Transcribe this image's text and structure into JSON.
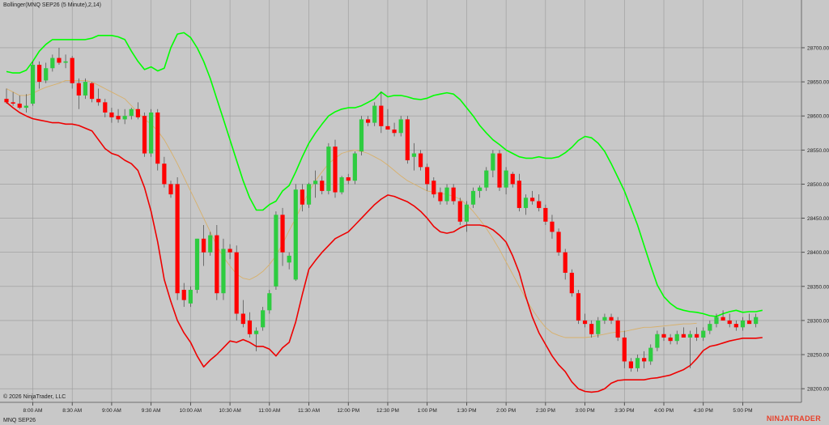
{
  "indicator_label": "Bollinger(MNQ SEP26 (5 Minute),2,14)",
  "copyright": "© 2026 NinjaTrader, LLC",
  "instrument": "MNQ SEP26",
  "brand": "NINJATRADER",
  "colors": {
    "background": "#c8c8c8",
    "grid": "#9a9a9a",
    "up_candle": "#2ecc40",
    "down_candle": "#ff0000",
    "upper_band": "#00ff00",
    "lower_band": "#ee0000",
    "middle_band": "#d8b06a",
    "wick": "#444444"
  },
  "chart_data": {
    "type": "candlestick",
    "title": "",
    "ylim": [
      28180,
      28770
    ],
    "y_ticks": [
      28200,
      28250,
      28300,
      28350,
      28400,
      28450,
      28500,
      28550,
      28600,
      28650,
      28700
    ],
    "y_tick_labels": [
      "28200.00",
      "28250.00",
      "28300.00",
      "28350.00",
      "28400.00",
      "28450.00",
      "28500.00",
      "28550.00",
      "28600.00",
      "28650.00",
      "28700.00"
    ],
    "x_ticks": [
      "8:00 AM",
      "8:30 AM",
      "9:00 AM",
      "9:30 AM",
      "10:00 AM",
      "10:30 AM",
      "11:00 AM",
      "11:30 AM",
      "12:00 PM",
      "12:30 PM",
      "1:00 PM",
      "1:30 PM",
      "2:00 PM",
      "2:30 PM",
      "3:00 PM",
      "3:30 PM",
      "4:00 PM",
      "4:30 PM",
      "5:00 PM"
    ],
    "bars_per_tick": 6,
    "first_tick_bar": 4,
    "grid": true,
    "candles": [
      [
        28625,
        28640,
        28618,
        28620
      ],
      [
        28620,
        28635,
        28615,
        28618
      ],
      [
        28618,
        28630,
        28610,
        28612
      ],
      [
        28612,
        28632,
        28605,
        28615
      ],
      [
        28618,
        28680,
        28615,
        28675
      ],
      [
        28675,
        28680,
        28640,
        28650
      ],
      [
        28652,
        28678,
        28648,
        28670
      ],
      [
        28670,
        28690,
        28665,
        28685
      ],
      [
        28685,
        28700,
        28675,
        28678
      ],
      [
        28678,
        28690,
        28670,
        28680
      ],
      [
        28685,
        28688,
        28640,
        28648
      ],
      [
        28648,
        28655,
        28610,
        28630
      ],
      [
        28630,
        28655,
        28625,
        28650
      ],
      [
        28648,
        28650,
        28620,
        28625
      ],
      [
        28625,
        28640,
        28615,
        28620
      ],
      [
        28620,
        28625,
        28598,
        28605
      ],
      [
        28605,
        28612,
        28590,
        28598
      ],
      [
        28600,
        28610,
        28590,
        28595
      ],
      [
        28595,
        28610,
        28588,
        28600
      ],
      [
        28600,
        28612,
        28595,
        28610
      ],
      [
        28610,
        28620,
        28595,
        28598
      ],
      [
        28600,
        28605,
        28540,
        28545
      ],
      [
        28545,
        28610,
        28540,
        28605
      ],
      [
        28605,
        28610,
        28520,
        28530
      ],
      [
        28530,
        28540,
        28495,
        28500
      ],
      [
        28500,
        28505,
        28480,
        28485
      ],
      [
        28500,
        28510,
        28330,
        28340
      ],
      [
        28345,
        28355,
        28320,
        28330
      ],
      [
        28325,
        28350,
        28320,
        28345
      ],
      [
        28345,
        28420,
        28340,
        28420
      ],
      [
        28420,
        28440,
        28380,
        28400
      ],
      [
        28400,
        28430,
        28395,
        28425
      ],
      [
        28425,
        28440,
        28330,
        28340
      ],
      [
        28340,
        28420,
        28330,
        28405
      ],
      [
        28405,
        28412,
        28390,
        28400
      ],
      [
        28400,
        28410,
        28300,
        28310
      ],
      [
        28310,
        28330,
        28290,
        28295
      ],
      [
        28300,
        28312,
        28275,
        28280
      ],
      [
        28280,
        28290,
        28255,
        28285
      ],
      [
        28290,
        28320,
        28285,
        28315
      ],
      [
        28315,
        28345,
        28310,
        28340
      ],
      [
        28350,
        28460,
        28345,
        28455
      ],
      [
        28455,
        28465,
        28380,
        28400
      ],
      [
        28385,
        28400,
        28375,
        28395
      ],
      [
        28360,
        28500,
        28358,
        28492
      ],
      [
        28492,
        28500,
        28460,
        28470
      ],
      [
        28470,
        28502,
        28465,
        28500
      ],
      [
        28500,
        28520,
        28480,
        28505
      ],
      [
        28505,
        28512,
        28485,
        28490
      ],
      [
        28490,
        28560,
        28485,
        28555
      ],
      [
        28555,
        28565,
        28480,
        28488
      ],
      [
        28488,
        28512,
        28485,
        28510
      ],
      [
        28510,
        28515,
        28500,
        28505
      ],
      [
        28505,
        28548,
        28500,
        28545
      ],
      [
        28548,
        28600,
        28542,
        28595
      ],
      [
        28595,
        28600,
        28585,
        28590
      ],
      [
        28590,
        28620,
        28585,
        28615
      ],
      [
        28615,
        28635,
        28575,
        28585
      ],
      [
        28585,
        28610,
        28580,
        28580
      ],
      [
        28580,
        28590,
        28570,
        28575
      ],
      [
        28575,
        28600,
        28570,
        28595
      ],
      [
        28595,
        28600,
        28530,
        28535
      ],
      [
        28540,
        28560,
        28520,
        28545
      ],
      [
        28545,
        28550,
        28520,
        28525
      ],
      [
        28525,
        28530,
        28490,
        28500
      ],
      [
        28505,
        28510,
        28480,
        28485
      ],
      [
        28488,
        28495,
        28470,
        28475
      ],
      [
        28475,
        28500,
        28470,
        28495
      ],
      [
        28495,
        28500,
        28470,
        28475
      ],
      [
        28475,
        28480,
        28440,
        28445
      ],
      [
        28445,
        28475,
        28430,
        28470
      ],
      [
        28470,
        28495,
        28465,
        28490
      ],
      [
        28490,
        28498,
        28480,
        28495
      ],
      [
        28495,
        28525,
        28490,
        28520
      ],
      [
        28520,
        28550,
        28510,
        28545
      ],
      [
        28545,
        28550,
        28490,
        28495
      ],
      [
        28495,
        28525,
        28485,
        28520
      ],
      [
        28515,
        28518,
        28495,
        28500
      ],
      [
        28505,
        28515,
        28460,
        28465
      ],
      [
        28465,
        28485,
        28455,
        28480
      ],
      [
        28480,
        28490,
        28470,
        28475
      ],
      [
        28475,
        28485,
        28460,
        28465
      ],
      [
        28465,
        28470,
        28440,
        28445
      ],
      [
        28445,
        28455,
        28420,
        28430
      ],
      [
        28430,
        28435,
        28395,
        28400
      ],
      [
        28400,
        28405,
        28360,
        28370
      ],
      [
        28370,
        28375,
        28335,
        28340
      ],
      [
        28340,
        28345,
        28295,
        28300
      ],
      [
        28300,
        28310,
        28290,
        28295
      ],
      [
        28295,
        28300,
        28275,
        28280
      ],
      [
        28280,
        28305,
        28275,
        28300
      ],
      [
        28300,
        28310,
        28295,
        28305
      ],
      [
        28305,
        28310,
        28295,
        28300
      ],
      [
        28300,
        28305,
        28270,
        28275
      ],
      [
        28275,
        28285,
        28230,
        28240
      ],
      [
        28240,
        28245,
        28225,
        28230
      ],
      [
        28230,
        28250,
        28225,
        28245
      ],
      [
        28245,
        28255,
        28230,
        28240
      ],
      [
        28240,
        28265,
        28235,
        28260
      ],
      [
        28260,
        28285,
        28255,
        28280
      ],
      [
        28280,
        28290,
        28270,
        28275
      ],
      [
        28275,
        28280,
        28265,
        28270
      ],
      [
        28270,
        28285,
        28265,
        28280
      ],
      [
        28280,
        28290,
        28275,
        28275
      ],
      [
        28275,
        28285,
        28230,
        28280
      ],
      [
        28280,
        28290,
        28270,
        28275
      ],
      [
        28275,
        28290,
        28270,
        28285
      ],
      [
        28285,
        28300,
        28280,
        28295
      ],
      [
        28295,
        28310,
        28290,
        28305
      ],
      [
        28305,
        28315,
        28300,
        28300
      ],
      [
        28300,
        28310,
        28290,
        28295
      ],
      [
        28295,
        28300,
        28285,
        28290
      ],
      [
        28290,
        28305,
        28285,
        28300
      ],
      [
        28300,
        28310,
        28295,
        28295
      ],
      [
        28295,
        28310,
        28290,
        28305
      ]
    ],
    "series": [
      {
        "values_upper": [
          28665,
          28663,
          28663,
          28667,
          28680,
          28695,
          28705,
          28712,
          28712,
          28712,
          28712,
          28712,
          28712,
          28714,
          28718,
          28718,
          28718,
          28716,
          28712,
          28695,
          28680,
          28668,
          28672,
          28666,
          28670,
          28700,
          28720,
          28722,
          28715,
          28700,
          28680,
          28655,
          28625,
          28595,
          28565,
          28535,
          28505,
          28480,
          28462,
          28462,
          28470,
          28475,
          28490,
          28498,
          28518,
          28540,
          28560,
          28575,
          28588,
          28600,
          28606,
          28610,
          28612,
          28612,
          28615,
          28620,
          28625,
          28635,
          28628,
          28630,
          28630,
          28628,
          28625,
          28624,
          28626,
          28630,
          28632,
          28634,
          28632,
          28624,
          28612,
          28600,
          28586,
          28575,
          28565,
          28558,
          28550,
          28545,
          28540,
          28538,
          28538,
          28540,
          28538,
          28538,
          28540,
          28546,
          28554,
          28564,
          28570,
          28568,
          28560,
          28548,
          28530,
          28510,
          28490,
          28465,
          28440,
          28410,
          28380,
          28352,
          28335,
          28325,
          28318,
          28315,
          28313,
          28312,
          28310,
          28307,
          28306,
          28310,
          28313,
          28315,
          28312,
          28313,
          28313,
          28315
        ]
      },
      {
        "values_middle": [
          28640,
          28635,
          28630,
          28630,
          28633,
          28638,
          28642,
          28645,
          28648,
          28652,
          28652,
          28652,
          28652,
          28650,
          28645,
          28640,
          28635,
          28630,
          28625,
          28615,
          28605,
          28595,
          28588,
          28578,
          28565,
          28548,
          28530,
          28510,
          28490,
          28470,
          28450,
          28430,
          28410,
          28393,
          28380,
          28368,
          28362,
          28360,
          28365,
          28372,
          28382,
          28395,
          28412,
          28432,
          28450,
          28470,
          28488,
          28505,
          28518,
          28530,
          28538,
          28545,
          28548,
          28550,
          28548,
          28545,
          28540,
          28535,
          28528,
          28520,
          28512,
          28505,
          28500,
          28495,
          28490,
          28488,
          28486,
          28485,
          28482,
          28478,
          28470,
          28460,
          28448,
          28435,
          28420,
          28404,
          28386,
          28368,
          28350,
          28332,
          28316,
          28302,
          28290,
          28282,
          28278,
          28275,
          28275,
          28275,
          28275,
          28276,
          28278,
          28280,
          28282,
          28283,
          28284,
          28286,
          28288,
          28290,
          28290,
          28291,
          28292,
          28293,
          28294,
          28295,
          28295,
          28296
        ]
      },
      {
        "values_lower": [
          28620,
          28612,
          28605,
          28600,
          28596,
          28594,
          28592,
          28590,
          28590,
          28588,
          28588,
          28586,
          28582,
          28578,
          28565,
          28552,
          28545,
          28542,
          28535,
          28530,
          28520,
          28495,
          28460,
          28415,
          28360,
          28328,
          28300,
          28282,
          28268,
          28248,
          28232,
          28242,
          28250,
          28260,
          28270,
          28268,
          28272,
          28268,
          28262,
          28262,
          28258,
          28248,
          28260,
          28268,
          28298,
          28338,
          28375,
          28388,
          28400,
          28410,
          28420,
          28425,
          28430,
          28440,
          28450,
          28460,
          28470,
          28478,
          28484,
          28482,
          28478,
          28474,
          28468,
          28460,
          28450,
          28438,
          28430,
          28428,
          28430,
          28436,
          28440,
          28440,
          28440,
          28438,
          28433,
          28425,
          28415,
          28395,
          28370,
          28335,
          28305,
          28282,
          28265,
          28248,
          28235,
          28225,
          28210,
          28200,
          28196,
          28195,
          28196,
          28200,
          28208,
          28212,
          28213,
          28213,
          28213,
          28213,
          28215,
          28216,
          28218,
          28220,
          28224,
          28228,
          28234,
          28244,
          28256,
          28262,
          28264,
          28267,
          28270,
          28272,
          28274,
          28274,
          28274,
          28275
        ]
      }
    ],
    "bands": [
      "upper",
      "middle",
      "lower"
    ]
  }
}
